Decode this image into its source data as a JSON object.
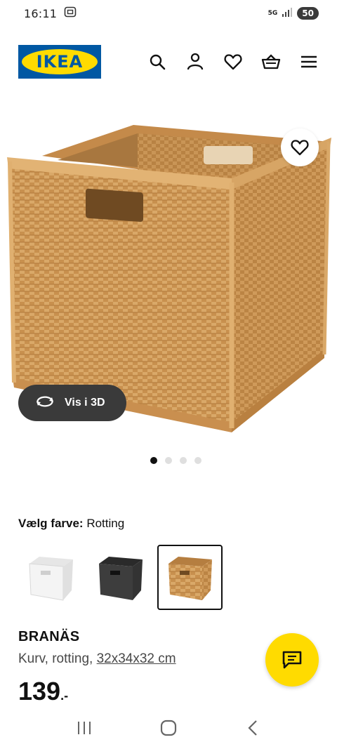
{
  "status_bar": {
    "time": "16:11",
    "network_label": "5G",
    "battery": "50"
  },
  "header": {
    "logo_text": "IKEA",
    "icons": [
      "search-icon",
      "user-icon",
      "heart-icon",
      "basket-icon",
      "menu-icon"
    ]
  },
  "gallery": {
    "view_3d_label": "Vis i 3D",
    "dots_count": 4,
    "active_dot": 0
  },
  "color_picker": {
    "label": "Vælg farve:",
    "selected_value": "Rotting",
    "swatches": [
      {
        "name": "white",
        "color": "#f2f2f2"
      },
      {
        "name": "dark-grey",
        "color": "#3b3b3b"
      },
      {
        "name": "rattan",
        "color": "#d4a56a"
      }
    ],
    "selected_index": 2
  },
  "product": {
    "name": "BRANÄS",
    "desc_prefix": "Kurv, rotting, ",
    "dimensions": "32x34x32 cm",
    "price": "139",
    "price_suffix": ".-"
  },
  "colors": {
    "brand_blue": "#0058a3",
    "brand_yellow": "#ffdb00"
  }
}
